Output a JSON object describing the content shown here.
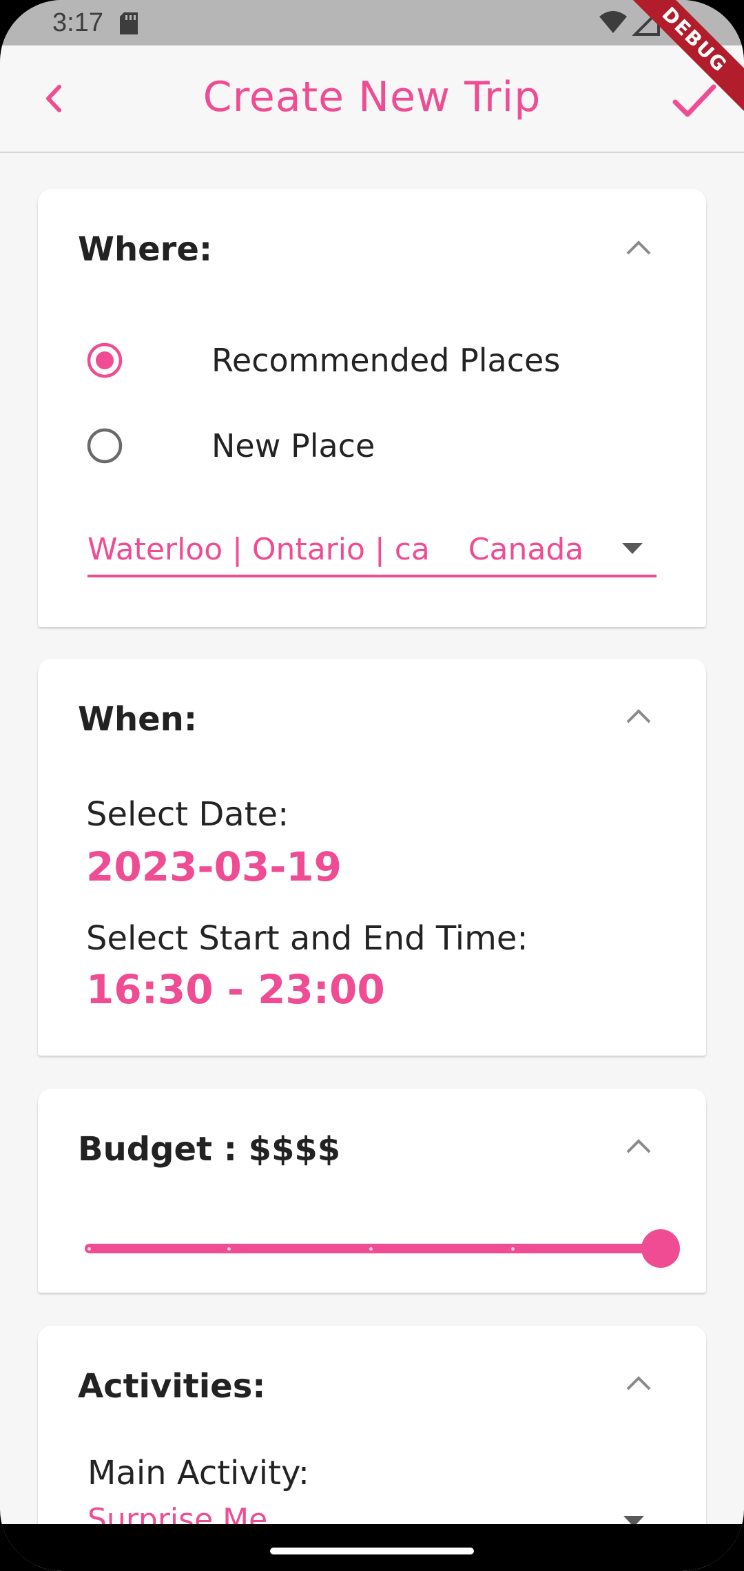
{
  "status_bar": {
    "time": "3:17"
  },
  "debug_banner": "DEBUG",
  "app_bar": {
    "title": "Create New Trip",
    "back_icon": "chevron-left-icon",
    "confirm_icon": "check-icon"
  },
  "where": {
    "title": "Where:",
    "options": [
      {
        "label": "Recommended Places",
        "selected": true
      },
      {
        "label": "New Place",
        "selected": false
      }
    ],
    "place_value": "Waterloo | Ontario | ca    Canada"
  },
  "when": {
    "title": "When:",
    "date_label": "Select Date:",
    "date_value": "2023-03-19",
    "time_label": "Select Start and End Time:",
    "time_value": "16:30 - 23:00"
  },
  "budget": {
    "title": "Budget : $$$$",
    "level": 4,
    "max_level": 4
  },
  "activities": {
    "title": "Activities:",
    "main_label": "Main Activity:",
    "main_value": "Surprise Me"
  },
  "colors": {
    "accent": "#ef4c93",
    "background": "#f6f6f6",
    "card": "#ffffff"
  }
}
